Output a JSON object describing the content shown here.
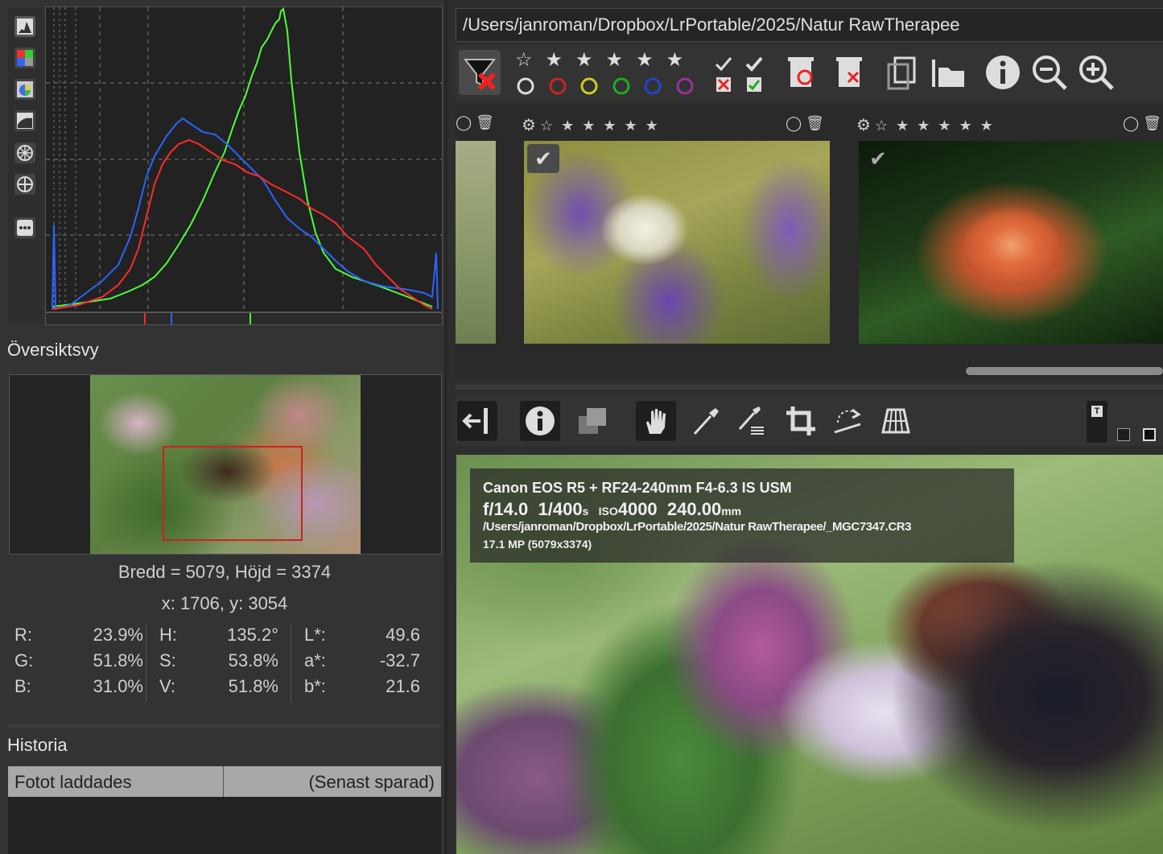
{
  "histogram": {
    "toolbar_icons": [
      "histogram-raw-icon",
      "rgb-channels-icon",
      "chroma-icon",
      "luminance-icon",
      "waveform-icon",
      "vectorscope-icon",
      "more-icon"
    ],
    "channels": {
      "red": "#ff2a2a",
      "green": "#4bff3a",
      "blue": "#2a64ff"
    }
  },
  "navigator": {
    "title": "Översiktsvy",
    "size_text": "Bredd = 5079, Höjd = 3374",
    "pos_text": "x: 1706, y: 3054",
    "rgb": [
      {
        "label": "R:",
        "value": "23.9%"
      },
      {
        "label": "G:",
        "value": "51.8%"
      },
      {
        "label": "B:",
        "value": "31.0%"
      }
    ],
    "hsv": [
      {
        "label": "H:",
        "value": "135.2°"
      },
      {
        "label": "S:",
        "value": "53.8%"
      },
      {
        "label": "V:",
        "value": "51.8%"
      }
    ],
    "lab": [
      {
        "label": "L*:",
        "value": "49.6"
      },
      {
        "label": "a*:",
        "value": "-32.7"
      },
      {
        "label": "b*:",
        "value": "21.6"
      }
    ]
  },
  "history": {
    "title": "Historia",
    "columns": [
      "Fotot laddades",
      "(Senast sparad)"
    ]
  },
  "filebrowser": {
    "path": "/Users/janroman/Dropbox/LrPortable/2025/Natur RawTherapee",
    "label_colors": [
      "#cc2222",
      "#cccc22",
      "#22aa22",
      "#2244cc",
      "#993399"
    ]
  },
  "exif": {
    "line1": "Canon EOS R5 + RF24-240mm F4-6.3 IS USM",
    "aperture": "f/14.0",
    "shutter": "1/400",
    "shutter_unit": "s",
    "iso_label": "ISO",
    "iso": "4000",
    "focal": "240.00",
    "focal_unit": "mm",
    "file": "/Users/janroman/Dropbox/LrPortable/2025/Natur RawTherapee/_MGC7347.CR3",
    "mp": "17.1 MP (5079x3374)"
  },
  "editor_toolbar": {
    "icons": [
      "hide-filmstrip-icon",
      "info-icon",
      "before-after-icon",
      "hand-icon",
      "white-balance-picker-icon",
      "color-picker-icon",
      "crop-icon",
      "straighten-icon",
      "perspective-icon"
    ]
  }
}
